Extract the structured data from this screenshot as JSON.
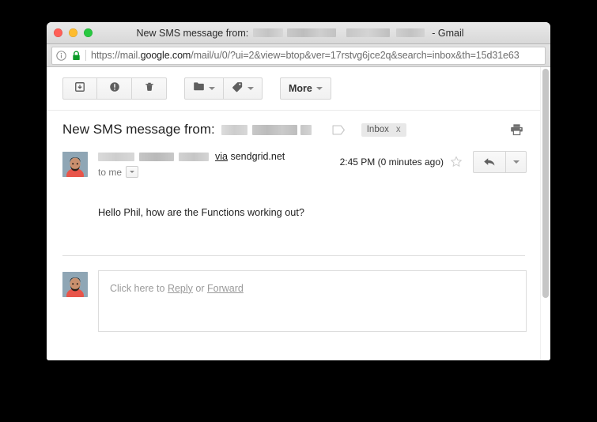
{
  "window": {
    "traffic_lights": [
      {
        "name": "close",
        "color": "#ff5f57"
      },
      {
        "name": "minimize",
        "color": "#febc2e"
      },
      {
        "name": "zoom",
        "color": "#28c840"
      }
    ],
    "title_prefix": "New SMS message from:",
    "title_suffix": "- Gmail"
  },
  "urlbar": {
    "info_icon": "info-circle-icon",
    "lock_icon": "padlock-icon",
    "url_scheme": "https://mail.",
    "url_host": "google.com",
    "url_path": "/mail/u/0/?ui=2&view=btop&ver=17rstvg6jce2q&search=inbox&th=15d31e63"
  },
  "toolbar": {
    "buttons": [
      {
        "name": "archive",
        "icon": "archive-box-icon",
        "label": ""
      },
      {
        "name": "report-spam",
        "icon": "exclamation-circle-icon",
        "label": ""
      },
      {
        "name": "delete",
        "icon": "trash-icon",
        "label": ""
      },
      {
        "name": "move-to",
        "icon": "folder-icon",
        "label": "",
        "caret": true
      },
      {
        "name": "labels",
        "icon": "tag-icon",
        "label": "",
        "caret": true
      },
      {
        "name": "more",
        "icon": "",
        "label": "More",
        "caret": true
      }
    ],
    "more_label": "More"
  },
  "subject": {
    "title": "New SMS message from:",
    "sender_redacted": true,
    "label_icon": "label-outline-icon",
    "chip_label": "Inbox",
    "chip_remove": "x",
    "print_icon": "printer-icon"
  },
  "message": {
    "avatar": "user-avatar",
    "sender_redacted": true,
    "via_prefix": "via",
    "via_domain": "sendgrid.net",
    "recipient": "to me",
    "timestamp": "2:45 PM (0 minutes ago)",
    "star_icon": "star-outline-icon",
    "reply_icon": "reply-arrow-icon",
    "more_icon": "chevron-down-icon",
    "body": "Hello Phil, how are the Functions working out?"
  },
  "reply": {
    "avatar": "user-avatar",
    "placeholder_prefix": "Click here to ",
    "reply_link": "Reply",
    "placeholder_middle": " or ",
    "forward_link": "Forward"
  },
  "colors": {
    "accent_green": "#28c840",
    "chrome_gray": "#e3e3e3",
    "text_primary": "#222222",
    "text_muted": "#777777"
  }
}
